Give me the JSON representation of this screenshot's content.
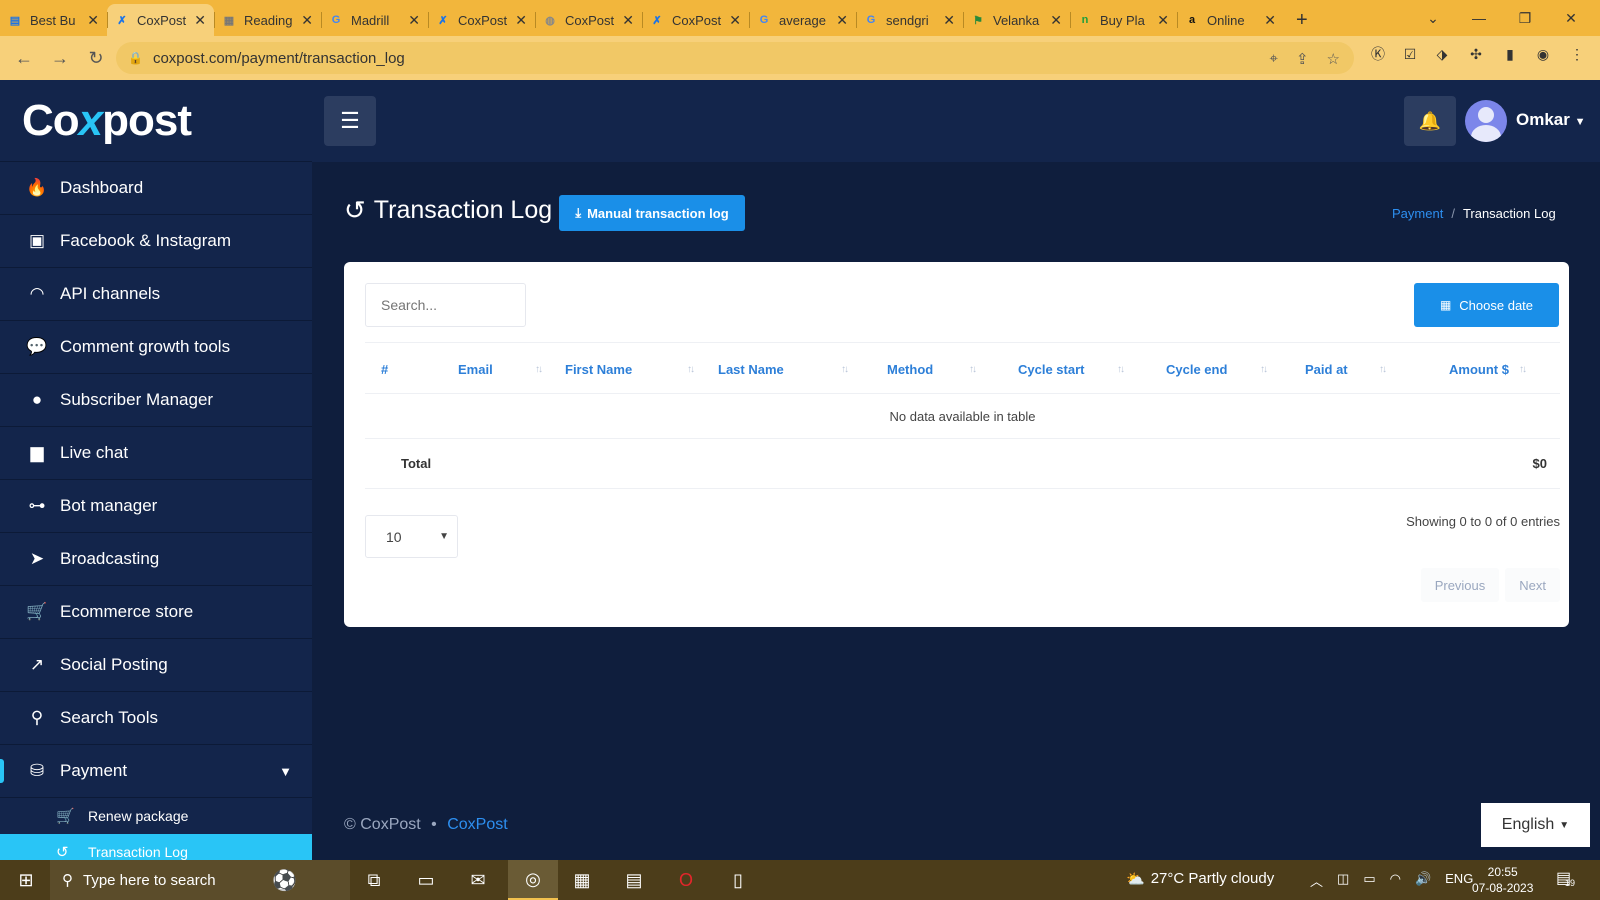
{
  "browser": {
    "tabs": [
      {
        "title": "Best Bu",
        "icon": "doc-icon",
        "favicon": "▤",
        "favicon_color": "#1a73e8"
      },
      {
        "title": "CoxPost",
        "icon": "coxpost-icon",
        "favicon": "✗",
        "favicon_color": "#1a73e8"
      },
      {
        "title": "Reading",
        "icon": "doc-icon",
        "favicon": "▦",
        "favicon_color": "#777"
      },
      {
        "title": "Madrill",
        "icon": "google-icon",
        "favicon": "G",
        "favicon_color": "#4285f4"
      },
      {
        "title": "CoxPost",
        "icon": "coxpost-icon",
        "favicon": "✗",
        "favicon_color": "#1a73e8"
      },
      {
        "title": "CoxPost",
        "icon": "globe-icon",
        "favicon": "◍",
        "favicon_color": "#888"
      },
      {
        "title": "CoxPost",
        "icon": "coxpost-icon",
        "favicon": "✗",
        "favicon_color": "#1a73e8"
      },
      {
        "title": "average",
        "icon": "google-icon",
        "favicon": "G",
        "favicon_color": "#4285f4"
      },
      {
        "title": "sendgri",
        "icon": "google-icon",
        "favicon": "G",
        "favicon_color": "#4285f4"
      },
      {
        "title": "Velanka",
        "icon": "flag-icon",
        "favicon": "⚑",
        "favicon_color": "#2a8a3a"
      },
      {
        "title": "Buy Pla",
        "icon": "n-icon",
        "favicon": "n",
        "favicon_color": "#1e9e3a"
      },
      {
        "title": "Online",
        "icon": "amazon-icon",
        "favicon": "a",
        "favicon_color": "#111"
      }
    ],
    "active_tab_index": 1,
    "url": "coxpost.com/payment/transaction_log"
  },
  "brand": {
    "logo_left": "Co",
    "logo_x": "x",
    "logo_right": "post"
  },
  "sidebar": {
    "items": [
      {
        "label": "Dashboard",
        "icon": "fire-icon",
        "glyph": "🔥"
      },
      {
        "label": "Facebook & Instagram",
        "icon": "facebook-icon",
        "glyph": "▣"
      },
      {
        "label": "API channels",
        "icon": "wifi-icon",
        "glyph": "◠"
      },
      {
        "label": "Comment growth tools",
        "icon": "comments-icon",
        "glyph": "💬"
      },
      {
        "label": "Subscriber Manager",
        "icon": "user-circle-icon",
        "glyph": "●"
      },
      {
        "label": "Live chat",
        "icon": "chat-icon",
        "glyph": "▆"
      },
      {
        "label": "Bot manager",
        "icon": "sitemap-icon",
        "glyph": "⊶"
      },
      {
        "label": "Broadcasting",
        "icon": "paper-plane-icon",
        "glyph": "➤"
      },
      {
        "label": "Ecommerce store",
        "icon": "cart-icon",
        "glyph": "🛒"
      },
      {
        "label": "Social Posting",
        "icon": "share-icon",
        "glyph": "↗"
      },
      {
        "label": "Search Tools",
        "icon": "search-icon",
        "glyph": "⚲"
      },
      {
        "label": "Payment",
        "icon": "coins-icon",
        "glyph": "⛁"
      }
    ],
    "sub_items": [
      {
        "label": "Renew package",
        "icon": "cart-icon",
        "glyph": "🛒"
      },
      {
        "label": "Transaction Log",
        "icon": "history-icon",
        "glyph": "↺"
      }
    ]
  },
  "header": {
    "username": "Omkar"
  },
  "page": {
    "title": "Transaction Log",
    "manual_button": "Manual transaction log",
    "breadcrumb": {
      "parent": "Payment",
      "separator": "/",
      "current": "Transaction Log"
    }
  },
  "table": {
    "search_placeholder": "Search...",
    "choose_date": "Choose date",
    "columns": [
      "#",
      "Email",
      "First Name",
      "Last Name",
      "Method",
      "Cycle start",
      "Cycle end",
      "Paid at",
      "Amount $"
    ],
    "empty_message": "No data available in table",
    "total_label": "Total",
    "total_value": "$0",
    "page_length": "10",
    "info": "Showing 0 to 0 of 0 entries",
    "prev": "Previous",
    "next": "Next"
  },
  "footer": {
    "copyright": "© CoxPost",
    "dot": "•",
    "brand": "CoxPost"
  },
  "language": "English",
  "taskbar": {
    "search_placeholder": "Type here to search",
    "weather": "27°C  Partly cloudy",
    "lang": "ENG",
    "time": "20:55",
    "date": "07-08-2023",
    "notifications": "19"
  },
  "colors": {
    "accent": "#1a8fe8",
    "sidebar": "#13254b",
    "active": "#29c5f6",
    "background": "#0f1e3d"
  }
}
